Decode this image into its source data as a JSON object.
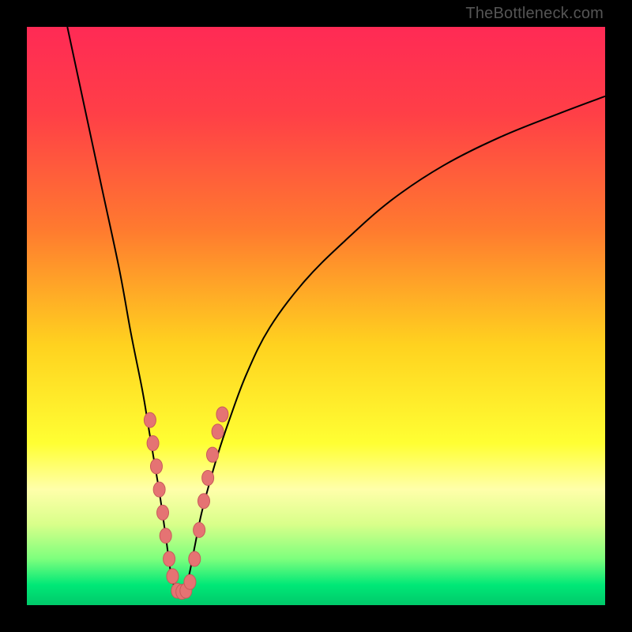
{
  "watermark": "TheBottleneck.com",
  "colors": {
    "frame": "#000000",
    "gradient_stops": [
      {
        "offset": 0.0,
        "color": "#ff2a55"
      },
      {
        "offset": 0.15,
        "color": "#ff3f47"
      },
      {
        "offset": 0.35,
        "color": "#ff7a2f"
      },
      {
        "offset": 0.55,
        "color": "#ffd21f"
      },
      {
        "offset": 0.72,
        "color": "#ffff33"
      },
      {
        "offset": 0.8,
        "color": "#ffffaa"
      },
      {
        "offset": 0.86,
        "color": "#d9ff8a"
      },
      {
        "offset": 0.92,
        "color": "#7dff7d"
      },
      {
        "offset": 0.965,
        "color": "#00e877"
      },
      {
        "offset": 1.0,
        "color": "#00c96a"
      }
    ],
    "curve_stroke": "#000000",
    "bead_fill": "#e57373",
    "bead_stroke": "#c85a5a"
  },
  "chart_data": {
    "type": "line",
    "title": "",
    "xlabel": "",
    "ylabel": "",
    "xlim": [
      0,
      100
    ],
    "ylim": [
      0,
      100
    ],
    "description": "V-shaped bottleneck curve. Left branch descends steeply from top-left to a minimum near x≈26, right branch rises more gradually toward 100. Background hue encodes severity (red=high bottleneck, green=balanced). Pink beads cluster near the bottom of the V indicating configurations close to optimal.",
    "series": [
      {
        "name": "left_branch",
        "x": [
          7,
          10,
          13,
          16,
          18,
          20,
          21,
          22,
          23,
          24,
          25,
          26
        ],
        "y": [
          100,
          86,
          72,
          58,
          47,
          37,
          31,
          25,
          19,
          12,
          5,
          2
        ]
      },
      {
        "name": "right_branch",
        "x": [
          27,
          28,
          29,
          30,
          31,
          33,
          35,
          38,
          42,
          48,
          55,
          63,
          72,
          82,
          92,
          100
        ],
        "y": [
          2,
          5,
          10,
          15,
          19,
          26,
          32,
          40,
          48,
          56,
          63,
          70,
          76,
          81,
          85,
          88
        ]
      }
    ],
    "beads": [
      {
        "x": 21.3,
        "y": 32
      },
      {
        "x": 21.8,
        "y": 28
      },
      {
        "x": 22.4,
        "y": 24
      },
      {
        "x": 22.9,
        "y": 20
      },
      {
        "x": 23.5,
        "y": 16
      },
      {
        "x": 24.0,
        "y": 12
      },
      {
        "x": 24.6,
        "y": 8
      },
      {
        "x": 25.2,
        "y": 5
      },
      {
        "x": 26.0,
        "y": 2.5
      },
      {
        "x": 26.8,
        "y": 2.3
      },
      {
        "x": 27.5,
        "y": 2.5
      },
      {
        "x": 28.2,
        "y": 4
      },
      {
        "x": 29.0,
        "y": 8
      },
      {
        "x": 29.8,
        "y": 13
      },
      {
        "x": 30.6,
        "y": 18
      },
      {
        "x": 31.3,
        "y": 22
      },
      {
        "x": 32.1,
        "y": 26
      },
      {
        "x": 33.0,
        "y": 30
      },
      {
        "x": 33.8,
        "y": 33
      }
    ]
  }
}
